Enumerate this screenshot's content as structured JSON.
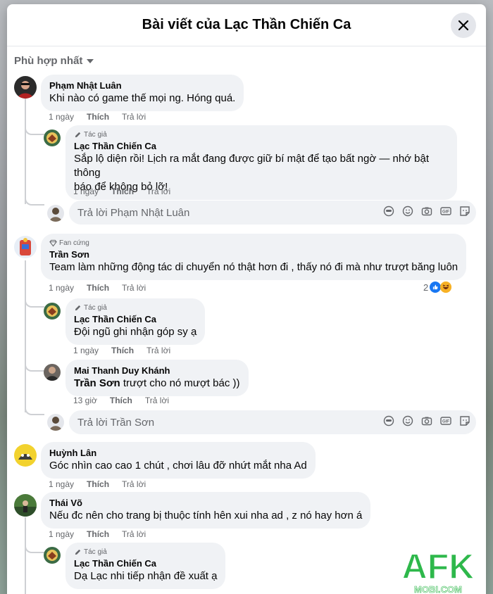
{
  "modal": {
    "title": "Bài viết của Lạc Thần Chiến Ca",
    "sort_label": "Phù hợp nhất"
  },
  "comments": [
    {
      "author": "Phạm Nhật Luân",
      "text": "Khi nào có game thế mọi ng. Hóng quá.",
      "time": "1 ngày",
      "like": "Thích",
      "reply": "Trả lời",
      "replies": [
        {
          "badge": "Tác giả",
          "author": "Lạc Thần Chiến Ca",
          "text_line1": "Sắp lộ diện rồi! Lịch ra mắt đang được giữ bí mật để tạo bất ngờ — nhớ bật thông",
          "text_line2": "báo để không bỏ lỡ!",
          "time": "1 ngày",
          "like": "Thích",
          "reply": "Trả lời"
        }
      ],
      "reply_placeholder": "Trả lời Phạm Nhật Luân"
    },
    {
      "badge": "Fan cứng",
      "author": "Trần Sơn",
      "text": "Team làm những động tác di chuyển nó thật hơn đi , thấy nó đi mà như trượt băng luôn",
      "time": "1 ngày",
      "like": "Thích",
      "reply": "Trả lời",
      "reaction_count": "2",
      "replies": [
        {
          "badge": "Tác giả",
          "author": "Lạc Thần Chiến Ca",
          "text": "Đội ngũ ghi nhận góp sy ạ",
          "time": "1 ngày",
          "like": "Thích",
          "reply": "Trả lời"
        },
        {
          "author": "Mai Thanh Duy Khánh",
          "mention": "Trần Sơn",
          "text": " trượt cho nó mượt bác ))",
          "time": "13 giờ",
          "like": "Thích",
          "reply": "Trả lời"
        }
      ],
      "reply_placeholder": "Trả lời Trần Sơn"
    },
    {
      "author": "Huỳnh Lân",
      "text": "Góc nhìn cao cao 1 chút , chơi lâu đỡ nhứt mắt nha Ad",
      "time": "1 ngày",
      "like": "Thích",
      "reply": "Trả lời"
    },
    {
      "author": "Thái Võ",
      "text": "Nếu đc nên cho trang bị thuộc tính hên xui nha ad , z nó hay hơn á",
      "time": "1 ngày",
      "like": "Thích",
      "reply": "Trả lời",
      "replies": [
        {
          "badge": "Tác giả",
          "author": "Lạc Thần Chiến Ca",
          "text": "Dạ Lạc nhi tiếp nhận đề xuất ạ"
        }
      ]
    }
  ],
  "watermark": {
    "brand": "AFK",
    "sub": "MOBI.COM"
  },
  "colors": {
    "bubble": "#f0f2f5",
    "muted": "#65676b",
    "like_blue": "#1877f2",
    "brand_green": "#2eb84b"
  }
}
